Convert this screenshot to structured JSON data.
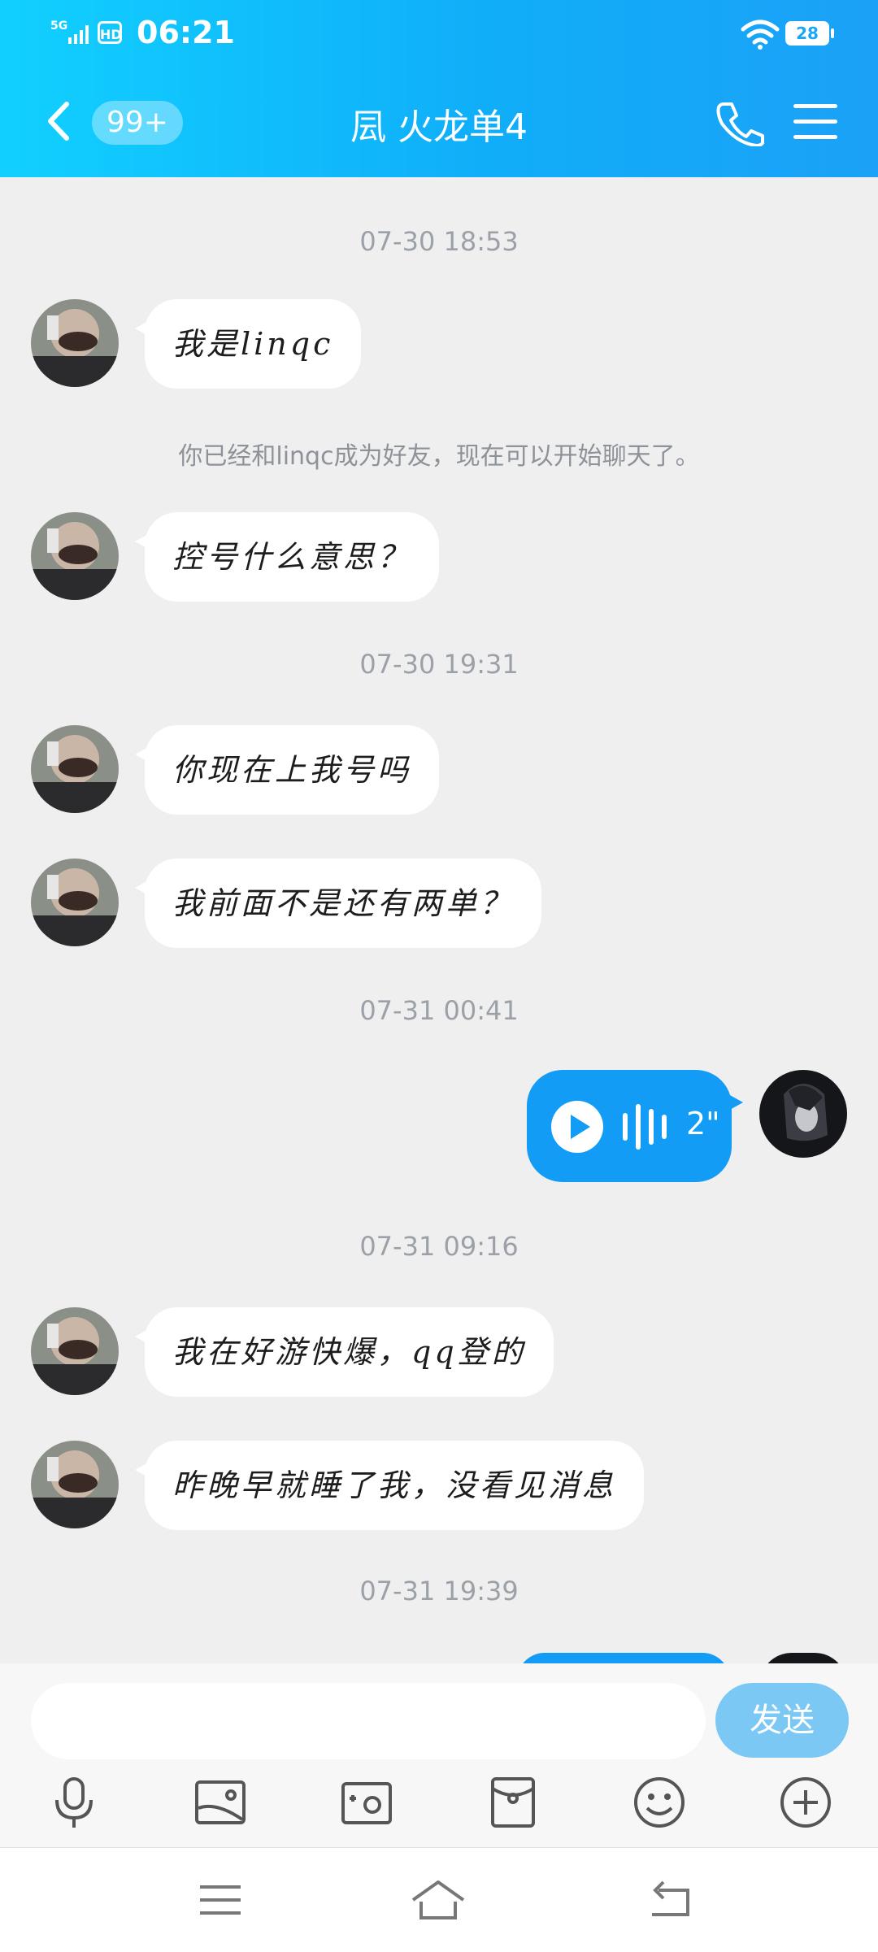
{
  "status_bar": {
    "network": "5G",
    "hd": "HD",
    "time": "06:21",
    "battery": "28"
  },
  "header": {
    "unread_badge": "99+",
    "title": "凨  火龙单4"
  },
  "messages": {
    "ts1": "07-30 18:53",
    "m1": "我是linqc",
    "sys1": "你已经和linqc成为好友，现在可以开始聊天了。",
    "m2": "控号什么意思？",
    "ts2": "07-30 19:31",
    "m3": "你现在上我号吗",
    "m4": "我前面不是还有两单？",
    "ts3": "07-31 00:41",
    "voice_duration": "2\"",
    "ts4": "07-31 09:16",
    "m5": "我在好游快爆，qq登的",
    "m6": "昨晚早就睡了我，没看见消息",
    "ts5": "07-31 19:39"
  },
  "input": {
    "placeholder": "",
    "send_label": "发送"
  },
  "colors": {
    "header_start": "#11d0ff",
    "header_end": "#1ba1f7",
    "voice_bubble": "#129cf5",
    "send_button": "#7cc8f5",
    "chat_bg": "#efeff0"
  }
}
